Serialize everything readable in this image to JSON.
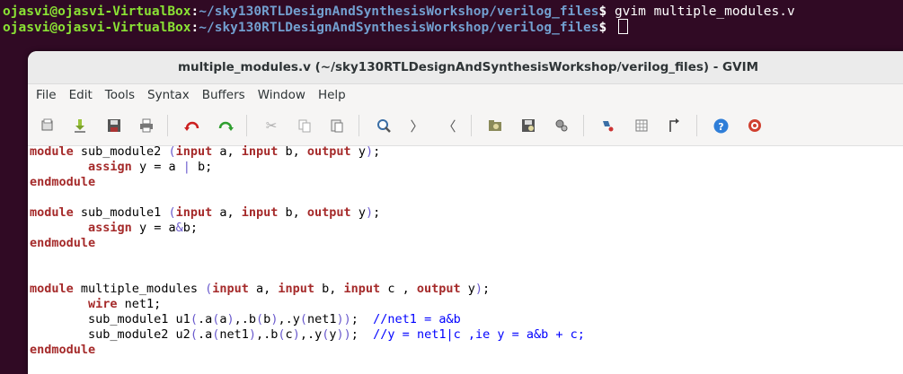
{
  "terminal": {
    "line1": {
      "user": "ojasvi@ojasvi-VirtualBox",
      "sep": ":",
      "path": "~/sky130RTLDesignAndSynthesisWorkshop/verilog_files",
      "dollar": "$ ",
      "command": "gvim multiple_modules.v"
    },
    "line2": {
      "user": "ojasvi@ojasvi-VirtualBox",
      "sep": ":",
      "path": "~/sky130RTLDesignAndSynthesisWorkshop/verilog_files",
      "dollar": "$ "
    }
  },
  "window": {
    "title": "multiple_modules.v (~/sky130RTLDesignAndSynthesisWorkshop/verilog_files) - GVIM"
  },
  "menu": [
    "File",
    "Edit",
    "Tools",
    "Syntax",
    "Buffers",
    "Window",
    "Help"
  ],
  "toolbar": {
    "icons": [
      "open-icon",
      "save-down-icon",
      "save-icon",
      "print-icon",
      "undo-icon",
      "redo-icon",
      "cut-icon",
      "copy-icon",
      "paste-icon",
      "find-replace-icon",
      "find-next-icon",
      "find-prev-icon",
      "load-session-icon",
      "save-session-icon",
      "run-script-icon",
      "make-icon",
      "shell-icon",
      "ctags-jump-icon",
      "help-icon",
      "find-help-icon"
    ]
  },
  "code_lines": [
    "module sub_module2 (input a, input b, output y);",
    "        assign y = a | b;",
    "endmodule",
    "",
    "module sub_module1 (input a, input b, output y);",
    "        assign y = a&b;",
    "endmodule",
    "",
    "",
    "module multiple_modules (input a, input b, input c , output y);",
    "        wire net1;",
    "        sub_module1 u1(.a(a),.b(b),.y(net1));  //net1 = a&b",
    "        sub_module2 u2(.a(net1),.b(c),.y(y));  //y = net1|c ,ie y = a&b + c;",
    "endmodule"
  ],
  "colors": {
    "terminal_bg": "#300a24",
    "prompt_user": "#8ae234",
    "prompt_path": "#729fcf",
    "keyword": "#a52a2a",
    "paren": "#6a5acd",
    "comment": "#0000ff"
  }
}
